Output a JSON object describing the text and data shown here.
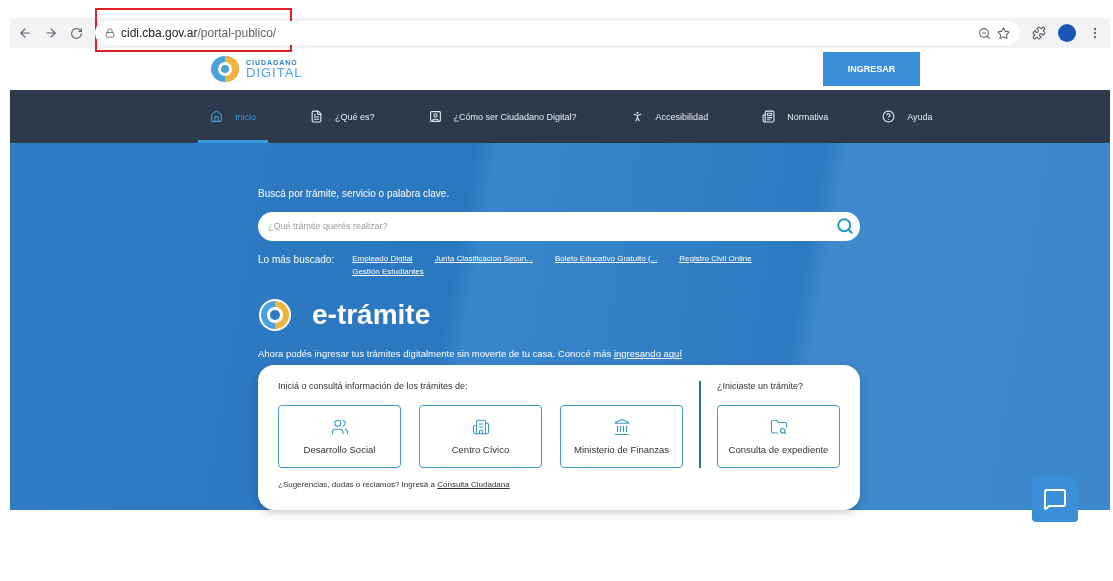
{
  "browser": {
    "url_host": "cidi.cba.gov.ar",
    "url_path": "/portal-publico/",
    "url_highlighted": true
  },
  "header": {
    "logo_top": "CIUDADANO",
    "logo_bottom": "DIGITAL",
    "login_button": "INGRESAR"
  },
  "nav": [
    {
      "label": "Inicio",
      "selected": true
    },
    {
      "label": "¿Qué es?",
      "selected": false
    },
    {
      "label": "¿Cómo ser Ciudadano Digital?",
      "selected": false
    },
    {
      "label": "Accesibilidad",
      "selected": false
    },
    {
      "label": "Normativa",
      "selected": false
    },
    {
      "label": "Ayuda",
      "selected": false
    }
  ],
  "search": {
    "title": "Buscá por trámite, servicio o palabra clave.",
    "placeholder": "¿Qué trámite querés realizar?",
    "popular_label": "Lo más buscado:",
    "popular": [
      "Empleado Digital",
      "Junta Clasificacion Secun...",
      "Boleto Educativo Gratuito (...",
      "Registro Civil Online",
      "Gestión Estudiantes"
    ]
  },
  "etramite": {
    "title": "e-trámite",
    "intro": "Ahora podés ingresar tus trámites digitalmente sin moverte de tu casa. Conocé más",
    "intro_link": "ingresando aquí"
  },
  "card": {
    "left_heading": "Iniciá o consultá información de los trámites de:",
    "right_heading": "¿Iniciaste un trámite?",
    "options": [
      {
        "label": "Desarrollo Social"
      },
      {
        "label": "Centro Cívico"
      },
      {
        "label": "Ministerio de Finanzas"
      }
    ],
    "right_option": {
      "label": "Consulta de expediente"
    },
    "footer": "¿Sugerencias, dudas o reclamos? Ingresá a",
    "footer_link": "Consulta Ciudadana"
  }
}
